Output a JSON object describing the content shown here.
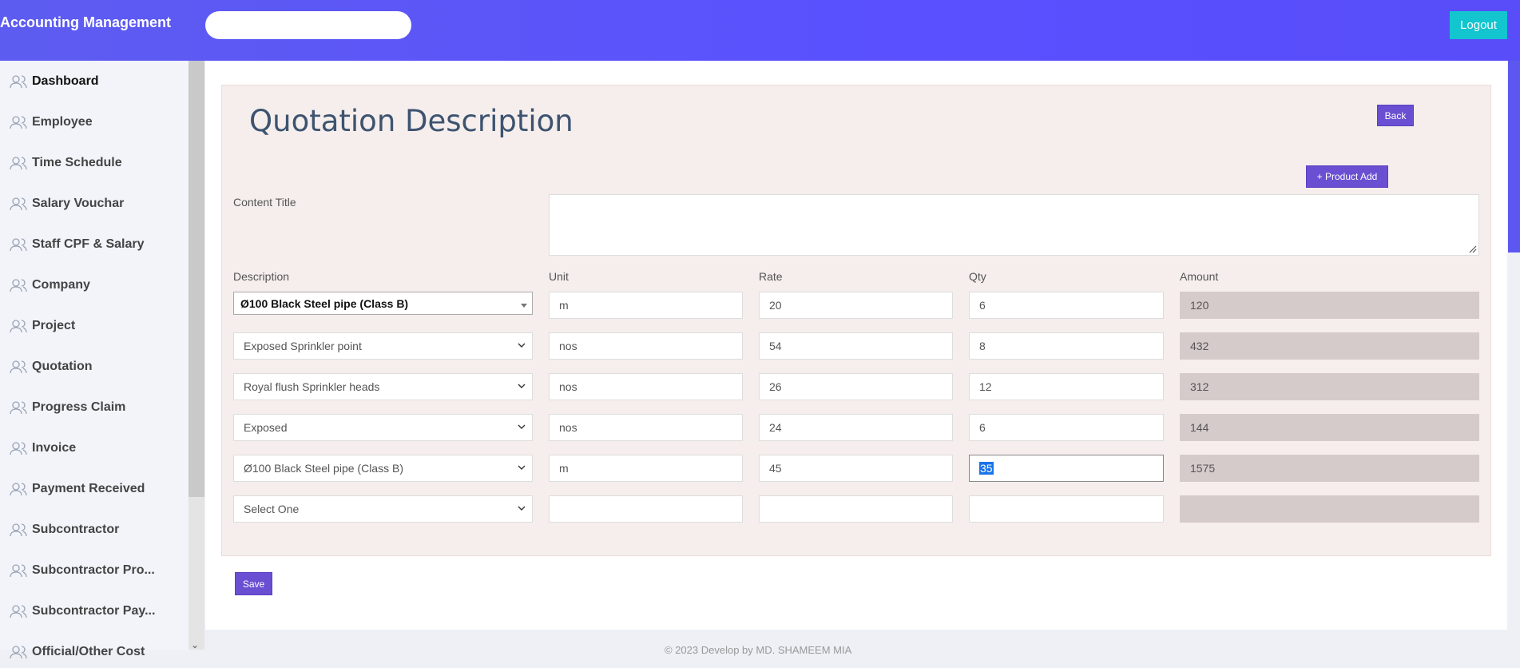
{
  "app": {
    "brand": "Accounting Management",
    "logout_label": "Logout",
    "search_placeholder": ""
  },
  "sidebar": {
    "items": [
      {
        "label": "Dashboard",
        "icon": "users-icon"
      },
      {
        "label": "Employee",
        "icon": "users-icon"
      },
      {
        "label": "Time Schedule",
        "icon": "users-icon"
      },
      {
        "label": "Salary Vouchar",
        "icon": "users-icon"
      },
      {
        "label": "Staff CPF & Salary",
        "icon": "users-icon"
      },
      {
        "label": "Company",
        "icon": "users-icon"
      },
      {
        "label": "Project",
        "icon": "users-icon"
      },
      {
        "label": "Quotation",
        "icon": "users-icon"
      },
      {
        "label": "Progress Claim",
        "icon": "users-icon"
      },
      {
        "label": "Invoice",
        "icon": "users-icon"
      },
      {
        "label": "Payment Received",
        "icon": "users-icon"
      },
      {
        "label": "Subcontractor",
        "icon": "users-icon"
      },
      {
        "label": "Subcontractor Pro...",
        "icon": "users-icon"
      },
      {
        "label": "Subcontractor Pay...",
        "icon": "users-icon"
      },
      {
        "label": "Official/Other Cost",
        "icon": "users-icon"
      }
    ]
  },
  "page": {
    "title": "Quotation Description",
    "back_label": "Back",
    "product_add_label": "+ Product Add",
    "content_title_label": "Content Title",
    "content_title_value": "",
    "save_label": "Save",
    "footer": "© 2023 Develop by MD. SHAMEEM MIA"
  },
  "table": {
    "headers": {
      "description": "Description",
      "unit": "Unit",
      "rate": "Rate",
      "qty": "Qty",
      "amount": "Amount"
    },
    "rows": [
      {
        "description": "Ø100 Black Steel pipe (Class B)",
        "unit": "m",
        "rate": "20",
        "qty": "6",
        "amount": "120"
      },
      {
        "description": "Exposed Sprinkler point",
        "unit": "nos",
        "rate": "54",
        "qty": "8",
        "amount": "432"
      },
      {
        "description": "Royal flush Sprinkler heads",
        "unit": "nos",
        "rate": "26",
        "qty": "12",
        "amount": "312"
      },
      {
        "description": "Exposed",
        "unit": "nos",
        "rate": "24",
        "qty": "6",
        "amount": "144"
      },
      {
        "description": "Ø100 Black Steel pipe (Class B)",
        "unit": "m",
        "rate": "45",
        "qty": "35",
        "amount": "1575"
      },
      {
        "description": "Select One",
        "unit": "",
        "rate": "",
        "qty": "",
        "amount": ""
      }
    ]
  },
  "colors": {
    "header": "#5a50ff",
    "logout": "#12c5cf",
    "button": "#6a4fd2",
    "panel": "#f5eeec",
    "amount_bg": "#d5cbca"
  }
}
